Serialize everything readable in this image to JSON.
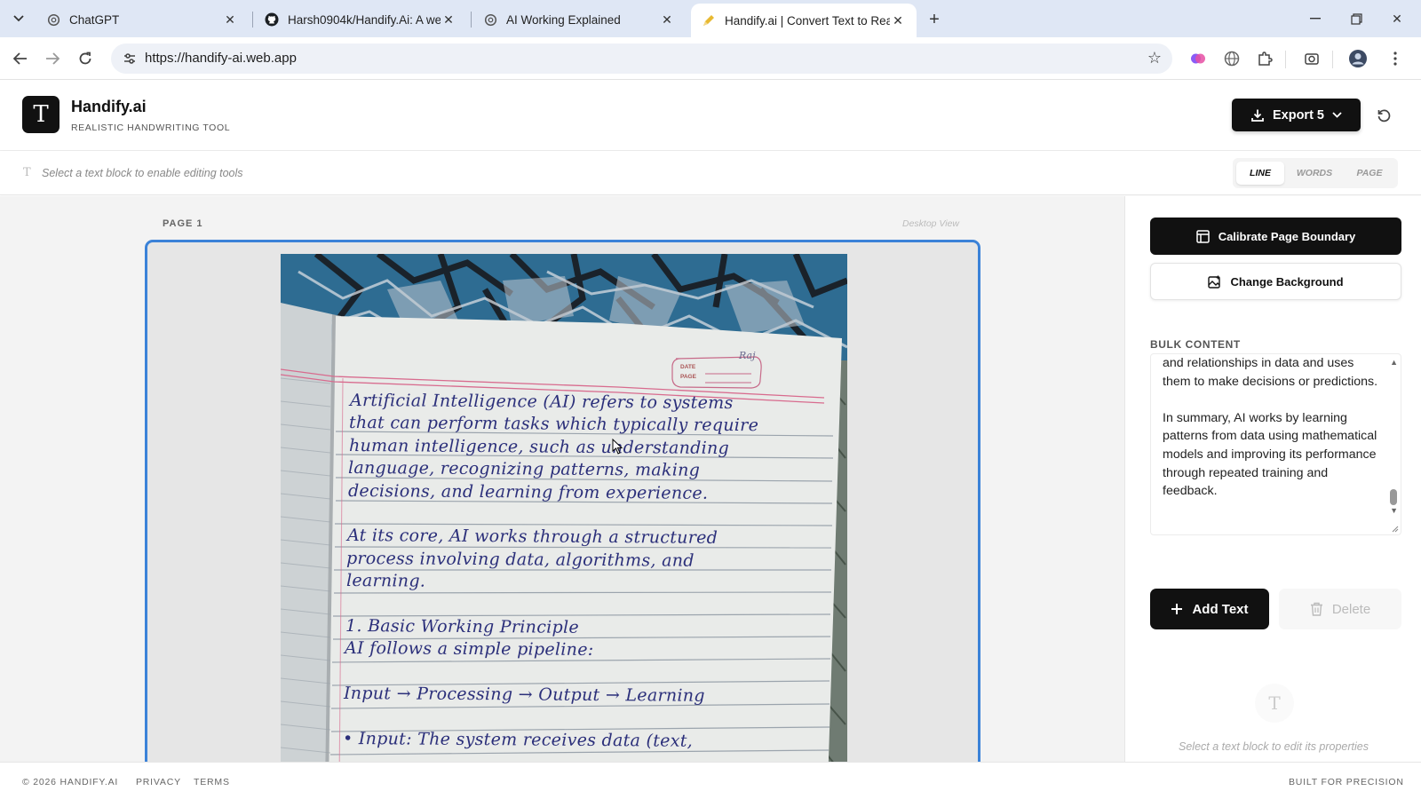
{
  "browser": {
    "tabs": [
      {
        "title": "ChatGPT",
        "icon": "chatgpt-icon"
      },
      {
        "title": "Harsh0904k/Handify.Ai: A web",
        "icon": "github-icon"
      },
      {
        "title": "AI Working Explained",
        "icon": "chatgpt-icon"
      },
      {
        "title": "Handify.ai | Convert Text to Rea",
        "icon": "pen-icon",
        "active": true
      }
    ],
    "url": "https://handify-ai.web.app"
  },
  "app": {
    "name": "Handify.ai",
    "tagline": "REALISTIC HANDWRITING TOOL",
    "logo_letter": "T",
    "export_label": "Export 5"
  },
  "editbar": {
    "hint": "Select a text block to enable editing tools",
    "modes": [
      "LINE",
      "WORDS",
      "PAGE"
    ],
    "active_mode": "LINE"
  },
  "canvas": {
    "page_label": "PAGE 1",
    "view_label": "Desktop View",
    "notebook": {
      "header_name": "Raj",
      "date_label": "DATE",
      "page_label": "PAGE",
      "lines": [
        "Artificial Intelligence (AI) refers to systems",
        "that can perform tasks which typically require",
        "human intelligence, such as understanding",
        "language, recognizing patterns, making",
        "decisions, and learning from experience.",
        "",
        "At its core, AI works through a structured",
        "process involving data, algorithms, and",
        "learning.",
        "",
        "1. Basic Working Principle",
        "AI follows a simple pipeline:",
        "",
        "Input → Processing → Output → Learning",
        "",
        "• Input: The system receives data (text,"
      ]
    }
  },
  "sidebar": {
    "calibrate_label": "Calibrate Page Boundary",
    "change_bg_label": "Change Background",
    "bulk_label": "BULK CONTENT",
    "bulk_text": "and relationships in data and uses them to make decisions or predictions.\n\nIn summary, AI works by learning patterns from data using mathematical models and improving its performance through repeated training and feedback.",
    "add_label": "Add Text",
    "delete_label": "Delete",
    "props_hint": "Select a text block to edit its properties"
  },
  "footer": {
    "copyright": "© 2026 HANDIFY.AI",
    "privacy": "PRIVACY",
    "terms": "TERMS",
    "tagline": "BUILT FOR PRECISION"
  },
  "colors": {
    "accent": "#3b82d8",
    "primary_button": "#111111",
    "ink": "#2b2f7a",
    "margin_line": "#d86b8e"
  }
}
